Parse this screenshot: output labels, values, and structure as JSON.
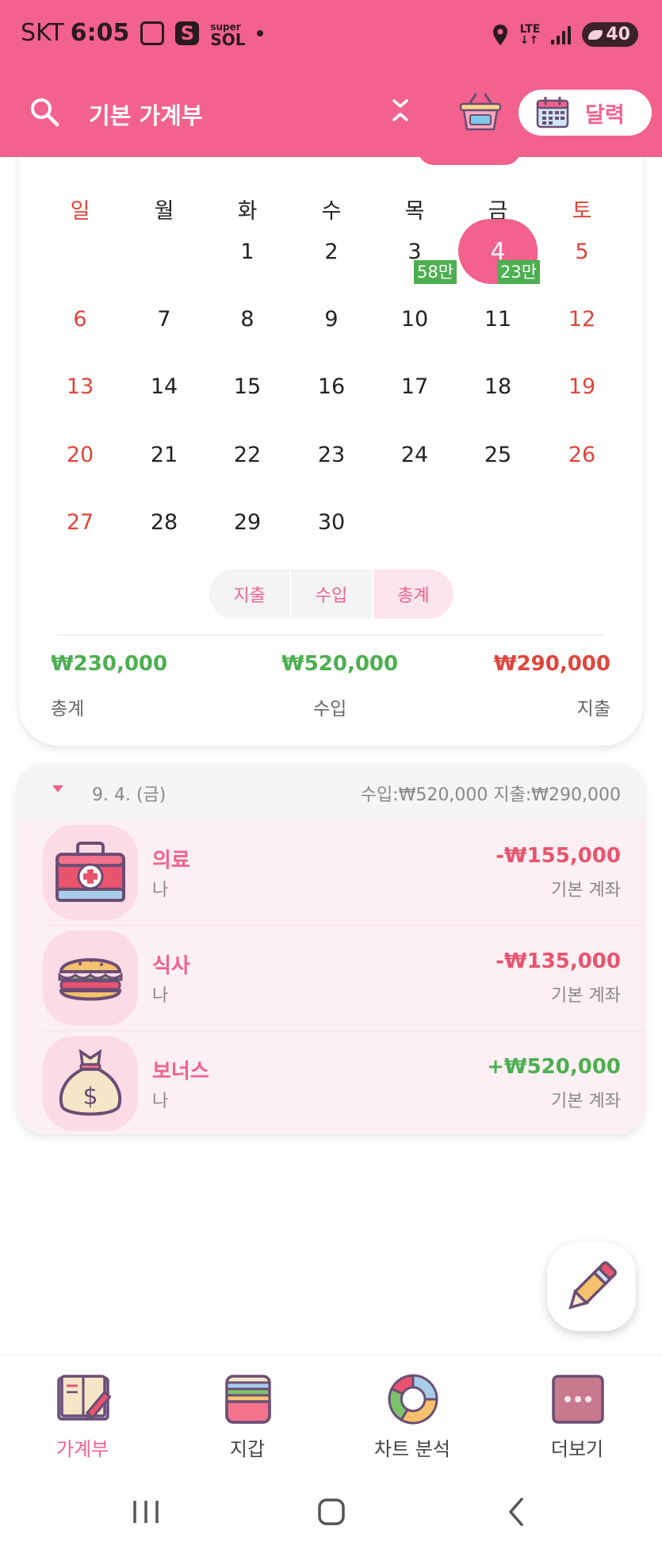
{
  "status_bar": {
    "carrier": "SKT",
    "time": "6:05",
    "app_s": "S",
    "app_sol_top": "super",
    "app_sol_bottom": "SOL",
    "network": "LTE",
    "battery": "40"
  },
  "app_bar": {
    "book_title": "기본 가계부",
    "calendar_toggle_label": "달력"
  },
  "calendar": {
    "weekdays": [
      "일",
      "월",
      "화",
      "수",
      "목",
      "금",
      "토"
    ],
    "weeks": [
      [
        "",
        "",
        "1",
        "2",
        "3",
        "4",
        "5"
      ],
      [
        "6",
        "7",
        "8",
        "9",
        "10",
        "11",
        "12"
      ],
      [
        "13",
        "14",
        "15",
        "16",
        "17",
        "18",
        "19"
      ],
      [
        "20",
        "21",
        "22",
        "23",
        "24",
        "25",
        "26"
      ],
      [
        "27",
        "28",
        "29",
        "30",
        "",
        "",
        ""
      ]
    ],
    "today": "4",
    "badges": {
      "thu_3": "58만",
      "fri_4": "23만"
    }
  },
  "segment": {
    "expense": "지출",
    "income": "수입",
    "total": "총계",
    "selected": "총계"
  },
  "summary": {
    "total_value": "₩230,000",
    "total_label": "총계",
    "income_value": "₩520,000",
    "income_label": "수입",
    "expense_value": "₩290,000",
    "expense_label": "지출"
  },
  "transactions": {
    "date": "9. 4. (금)",
    "totals": "수입:₩520,000 지출:₩290,000",
    "items": [
      {
        "category": "의료",
        "who": "나",
        "amount": "-₩155,000",
        "account": "기본 계좌",
        "icon": "medical-kit-icon"
      },
      {
        "category": "식사",
        "who": "나",
        "amount": "-₩135,000",
        "account": "기본 계좌",
        "icon": "burger-icon"
      },
      {
        "category": "보너스",
        "who": "나",
        "amount": "+₩520,000",
        "account": "기본 계좌",
        "icon": "money-bag-icon"
      }
    ]
  },
  "bottom_nav": {
    "items": [
      {
        "label": "가계부",
        "icon": "ledger-book-icon",
        "active": true
      },
      {
        "label": "지갑",
        "icon": "wallet-icon",
        "active": false
      },
      {
        "label": "차트 분석",
        "icon": "donut-chart-icon",
        "active": false
      },
      {
        "label": "더보기",
        "icon": "more-dots-icon",
        "active": false
      }
    ]
  },
  "colors": {
    "brand_pink": "#f2628c",
    "income_green": "#4caf50",
    "expense_red": "#e0453c",
    "sunday_red": "#e0453c"
  }
}
